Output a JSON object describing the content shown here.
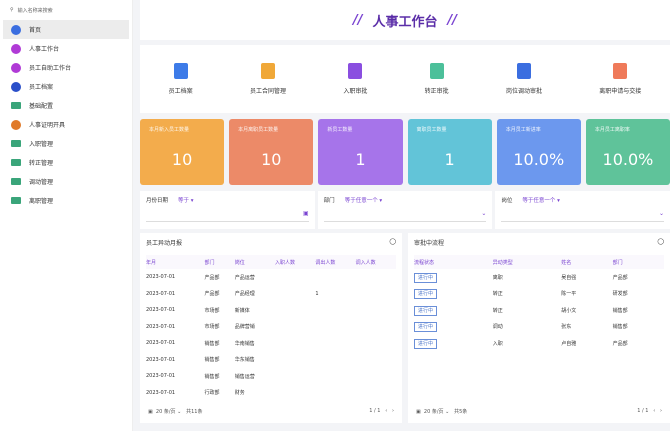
{
  "sidebar": {
    "search_placeholder": "输入名称来搜索",
    "items": [
      {
        "label": "首页",
        "color": "#3b6ee0"
      },
      {
        "label": "人事工作台",
        "color": "#b03ad6"
      },
      {
        "label": "员工自助工作台",
        "color": "#b03ad6"
      },
      {
        "label": "员工档案",
        "color": "#2a4fc9"
      },
      {
        "label": "基础配置",
        "color": "folder"
      },
      {
        "label": "人事证明开具",
        "color": "#e07a2a"
      },
      {
        "label": "入职管理",
        "color": "folder"
      },
      {
        "label": "转正管理",
        "color": "folder"
      },
      {
        "label": "调动管理",
        "color": "folder"
      },
      {
        "label": "离职管理",
        "color": "folder"
      }
    ]
  },
  "header": {
    "title": "人事工作台"
  },
  "quick": [
    {
      "label": "员工档案",
      "color": "#3d7be8"
    },
    {
      "label": "员工合同管理",
      "color": "#f0a838"
    },
    {
      "label": "入职审批",
      "color": "#8a4ee0"
    },
    {
      "label": "转正审批",
      "color": "#4cc09a"
    },
    {
      "label": "岗位调动审批",
      "color": "#3b6ee0"
    },
    {
      "label": "离职申请与交接",
      "color": "#ef7a5a"
    }
  ],
  "cards": [
    {
      "label": "本月新入员工数量",
      "value": "10",
      "color": "#f3ac4c"
    },
    {
      "label": "本月离职员工数量",
      "value": "10",
      "color": "#ec8a68"
    },
    {
      "label": "新员工数量",
      "value": "1",
      "color": "#a674ea"
    },
    {
      "label": "离职员工数量",
      "value": "1",
      "color": "#62c4d8"
    },
    {
      "label": "本月员工新进率",
      "value": "10.0%",
      "color": "#6c98ee"
    },
    {
      "label": "本月员工离职率",
      "value": "10.0%",
      "color": "#5fc39a"
    }
  ],
  "filters": [
    {
      "label": "月份日期",
      "op": "等于 ▾",
      "icon": "▣"
    },
    {
      "label": "部门",
      "op": "等于任意一个 ▾",
      "icon": "⌄"
    },
    {
      "label": "岗位",
      "op": "等于任意一个 ▾",
      "icon": "⌄"
    }
  ],
  "left": {
    "title": "员工异动月报",
    "headers": [
      "年月",
      "部门",
      "岗位",
      "入职人数",
      "调出人数",
      "调入人数"
    ],
    "rows": [
      [
        "2023-07-01",
        "产品部",
        "产品运营",
        "",
        "",
        ""
      ],
      [
        "2023-07-01",
        "产品部",
        "产品经理",
        "",
        "1",
        ""
      ],
      [
        "2023-07-01",
        "市场部",
        "新媒体",
        "",
        "",
        ""
      ],
      [
        "2023-07-01",
        "市场部",
        "品牌营销",
        "",
        "",
        ""
      ],
      [
        "2023-07-01",
        "销售部",
        "华南销售",
        "",
        "",
        ""
      ],
      [
        "2023-07-01",
        "销售部",
        "华东销售",
        "",
        "",
        ""
      ],
      [
        "2023-07-01",
        "销售部",
        "销售运营",
        "",
        "",
        ""
      ],
      [
        "2023-07-01",
        "行政部",
        "财务",
        "",
        "",
        ""
      ]
    ],
    "page_size": "20 条/页",
    "total": "共11条",
    "page": "1 / 1"
  },
  "right": {
    "title": "审批中流程",
    "headers": [
      "流程状态",
      "异动类型",
      "姓名",
      "部门"
    ],
    "rows": [
      [
        "进行中",
        "离职",
        "吴自强",
        "产品部"
      ],
      [
        "进行中",
        "转正",
        "陈一平",
        "研发部"
      ],
      [
        "进行中",
        "转正",
        "胡小文",
        "销售部"
      ],
      [
        "进行中",
        "调动",
        "张东",
        "销售部"
      ],
      [
        "进行中",
        "入职",
        "卢自雅",
        "产品部"
      ]
    ],
    "page_size": "20 条/页",
    "total": "共5条",
    "page": "1 / 1"
  }
}
